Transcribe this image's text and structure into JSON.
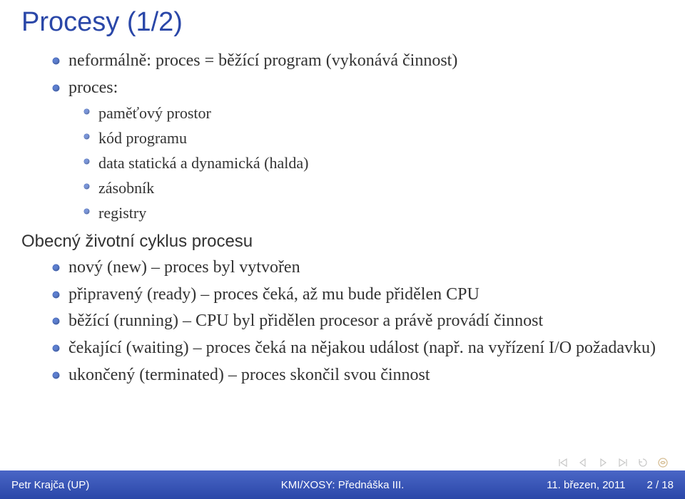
{
  "title": "Procesy (1/2)",
  "bullets1": [
    "neformálně: proces = běžící program (vykonává činnost)",
    "proces:"
  ],
  "bullets2": [
    "paměťový prostor",
    "kód programu",
    "data statická a dynamická (halda)",
    "zásobník",
    "registry"
  ],
  "subhead": "Obecný životní cyklus procesu",
  "bullets3": [
    "nový (new) – proces byl vytvořen",
    "připravený (ready) – proces čeká, až mu bude přidělen CPU",
    "běžící (running) – CPU byl přidělen procesor a právě provádí činnost",
    "čekající (waiting) – proces čeká na nějakou událost (např. na vyřízení I/O požadavku)",
    "ukončený (terminated) – proces skončil svou činnost"
  ],
  "footer": {
    "left": "Petr Krajča (UP)",
    "center": "KMI/XOSY: Přednáška III.",
    "right": "11. březen, 2011  2 / 18"
  }
}
